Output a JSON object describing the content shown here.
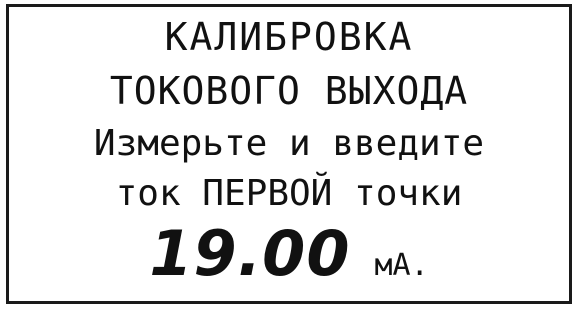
{
  "display": {
    "line1": "КАЛИБРОВКА",
    "line2": "ТОКОВОГО ВЫХОДА",
    "line3": "Измерьте и введите",
    "line4": "ток ПЕРВОЙ точки",
    "value": "19.00",
    "unit": "мА."
  }
}
